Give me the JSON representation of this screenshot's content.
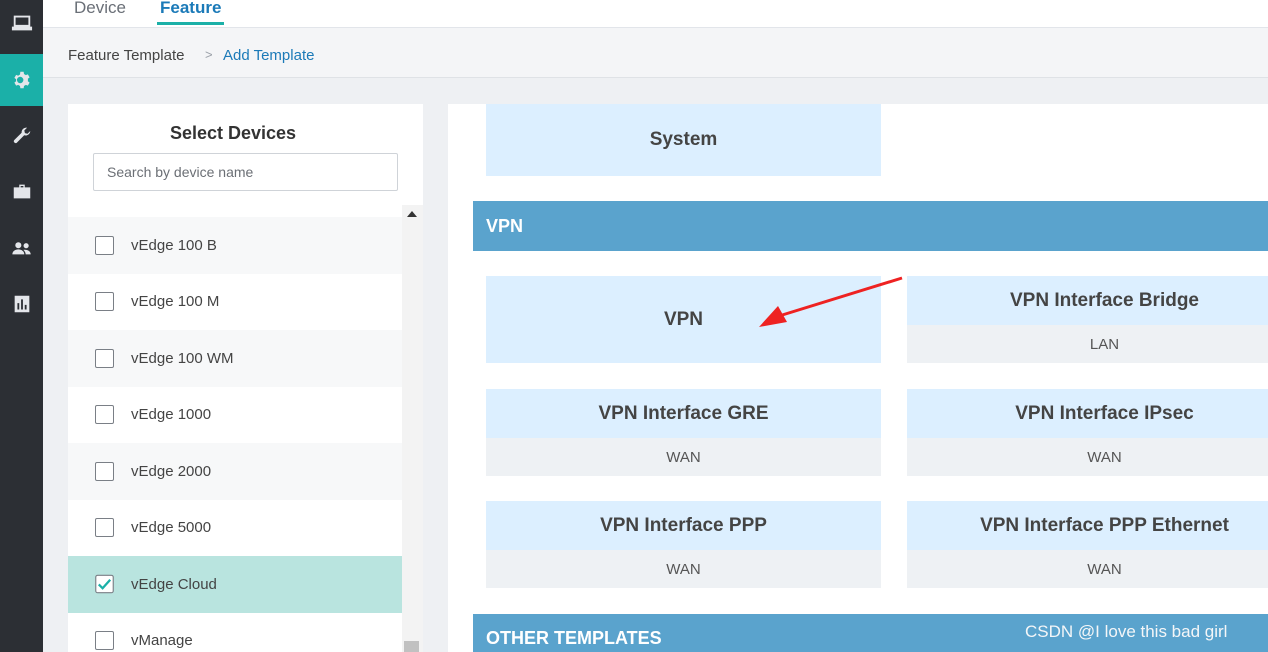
{
  "sidebar": {
    "icons": [
      "monitor-icon",
      "gear-icon",
      "wrench-icon",
      "toolkit-icon",
      "users-icon",
      "chart-icon"
    ],
    "active": "gear-icon"
  },
  "tabs": [
    {
      "label": "Device",
      "active": false
    },
    {
      "label": "Feature",
      "active": true
    }
  ],
  "breadcrumb": {
    "parent": "Feature Template",
    "separator": ">",
    "current": "Add Template"
  },
  "select_devices": {
    "title": "Select Devices",
    "search_placeholder": "Search by device name",
    "items": [
      {
        "label": "vEdge 100 B",
        "checked": false
      },
      {
        "label": "vEdge 100 M",
        "checked": false
      },
      {
        "label": "vEdge 100 WM",
        "checked": false
      },
      {
        "label": "vEdge 1000",
        "checked": false
      },
      {
        "label": "vEdge 2000",
        "checked": false
      },
      {
        "label": "vEdge 5000",
        "checked": false
      },
      {
        "label": "vEdge Cloud",
        "checked": true
      },
      {
        "label": "vManage",
        "checked": false
      }
    ]
  },
  "templates": {
    "system_card": {
      "title": "System"
    },
    "vpn_section": {
      "label": "VPN"
    },
    "cards": [
      {
        "title": "VPN",
        "subtitle": ""
      },
      {
        "title": "VPN Interface Bridge",
        "subtitle": "LAN"
      },
      {
        "title": "VPN Interface GRE",
        "subtitle": "WAN"
      },
      {
        "title": "VPN Interface IPsec",
        "subtitle": "WAN"
      },
      {
        "title": "VPN Interface PPP",
        "subtitle": "WAN"
      },
      {
        "title": "VPN Interface PPP Ethernet",
        "subtitle": "WAN"
      }
    ],
    "other_section": {
      "label": "OTHER TEMPLATES"
    }
  },
  "watermark": "CSDN @I love this bad girl",
  "colors": {
    "sidebar_bg": "#2c2f34",
    "sidebar_active": "#1bb0a8",
    "section_bar": "#5aa3cd",
    "card_top": "#dcefff",
    "checked_row": "#b9e4df",
    "link": "#1b7ab8",
    "arrow": "#ee2222"
  }
}
